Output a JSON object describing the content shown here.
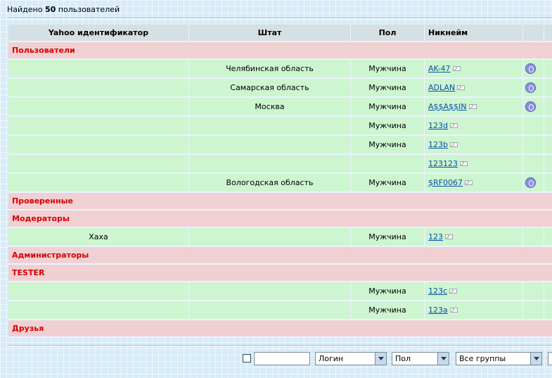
{
  "summary": {
    "prefix": "Найдено",
    "count": "50",
    "suffix": "пользователей"
  },
  "columns": {
    "yahoo": "Yahoo идентификатор",
    "state": "Штат",
    "gender": "Пол",
    "nickname": "Никнейм"
  },
  "groups": [
    {
      "name": "Пользователи",
      "rows": [
        {
          "yahoo": "",
          "state": "Челябинская область",
          "gender": "Мужчина",
          "nick": "AK-47",
          "messenger": true
        },
        {
          "yahoo": "",
          "state": "Самарская область",
          "gender": "Мужчина",
          "nick": "ADLAN",
          "messenger": true
        },
        {
          "yahoo": "",
          "state": "Москва",
          "gender": "Мужчина",
          "nick": "A$$A$$IN",
          "messenger": true
        },
        {
          "yahoo": "",
          "state": "",
          "gender": "Мужчина",
          "nick": "123d",
          "messenger": false
        },
        {
          "yahoo": "",
          "state": "",
          "gender": "Мужчина",
          "nick": "123b",
          "messenger": false
        },
        {
          "yahoo": "",
          "state": "",
          "gender": "",
          "nick": "123123",
          "messenger": false
        },
        {
          "yahoo": "",
          "state": "Вологодская область",
          "gender": "Мужчина",
          "nick": "$RF0067",
          "messenger": true
        }
      ]
    },
    {
      "name": "Проверенные",
      "rows": []
    },
    {
      "name": "Модераторы",
      "rows": [
        {
          "yahoo": "Хаха",
          "state": "",
          "gender": "Мужчина",
          "nick": "123",
          "messenger": false
        }
      ]
    },
    {
      "name": "Администраторы",
      "rows": []
    },
    {
      "name": "TESTER",
      "rows": [
        {
          "yahoo": "",
          "state": "",
          "gender": "Мужчина",
          "nick": "123c",
          "messenger": false
        },
        {
          "yahoo": "",
          "state": "",
          "gender": "Мужчина",
          "nick": "123a",
          "messenger": false
        }
      ]
    },
    {
      "name": "Друзья",
      "rows": []
    }
  ],
  "filters": {
    "text_value": "",
    "field_select": "Логин",
    "gender_select": "Пол",
    "group_select": "Все группы"
  },
  "icons": {
    "mail": "envelope-icon",
    "messenger": "yahoo-messenger-icon"
  },
  "colors": {
    "group_text": "#d60000",
    "group_bg": "#f0d0d3",
    "row_bg": "#ccf5d0",
    "header_bg": "#d6dfe3",
    "link": "#0c4fa8"
  }
}
